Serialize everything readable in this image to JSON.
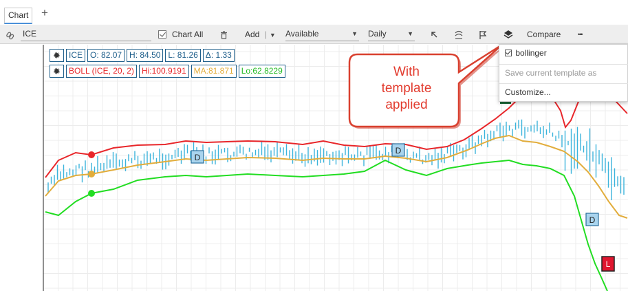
{
  "tabs": {
    "active_label": "Chart",
    "add_symbol": "+"
  },
  "toolbar": {
    "symbol": "ICE",
    "chart_all_label": "Chart All",
    "add_label": "Add",
    "available_label": "Available",
    "interval_label": "Daily",
    "compare_label": "Compare",
    "more_label": "•••"
  },
  "legend": {
    "price": {
      "symbol": "ICE",
      "open": "O: 82.07",
      "high": "H: 84.50",
      "low": "L: 81.26",
      "change": "Δ: 1.33"
    },
    "boll": {
      "name": "BOLL (ICE, 20, 2)",
      "hi": "Hi:100.9191",
      "ma": "MA:81.871",
      "lo": "Lo:62.8229"
    }
  },
  "colors": {
    "upper_band": "#e8262a",
    "middle_band": "#e2ad3c",
    "lower_band": "#22dd22",
    "price_bars": "#3bb4dc",
    "marker_fill": "#a9d4ee",
    "marker_red": "#e0162f",
    "callout": "#e23b2e",
    "legend_border": "#1f5f8b"
  },
  "markers": [
    {
      "label": "D"
    },
    {
      "label": "D"
    },
    {
      "label": "D"
    },
    {
      "label": "L"
    }
  ],
  "template_menu": {
    "items": [
      {
        "label": "bollinger",
        "checked": true
      },
      {
        "label": "Save current template as",
        "disabled": true
      },
      {
        "label": "Customize..."
      }
    ]
  },
  "callout": {
    "line1": "With",
    "line2": "template",
    "line3": "applied"
  }
}
